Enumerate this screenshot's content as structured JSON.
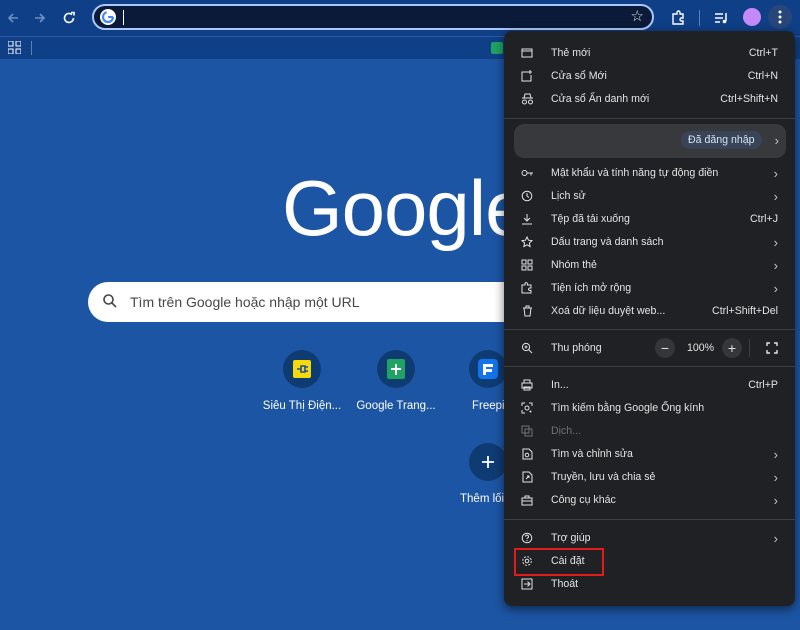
{
  "browser": {
    "omnibox_value": "",
    "bookmarks": [],
    "colors": {
      "page_bg": "#1c55a4",
      "menu_bg": "#202124",
      "highlight": "#e21b1b"
    }
  },
  "newtab": {
    "logo": "Google",
    "search_placeholder": "Tìm trên Google hoặc nhập một URL",
    "shortcuts": [
      {
        "label": "Siêu Thị Điện...",
        "icon": "plug-icon"
      },
      {
        "label": "Google Trang...",
        "icon": "sheets-icon"
      },
      {
        "label": "Freepik",
        "icon": "freepik-icon"
      }
    ],
    "add_shortcut": "Thêm lối"
  },
  "menu": {
    "new_tab": {
      "label": "Thẻ mới",
      "shortcut": "Ctrl+T"
    },
    "new_window": {
      "label": "Cửa sổ Mới",
      "shortcut": "Ctrl+N"
    },
    "incognito": {
      "label": "Cửa sổ Ẩn danh mới",
      "shortcut": "Ctrl+Shift+N"
    },
    "profile_status": "Đã đăng nhập",
    "passwords": "Mật khẩu và tính năng tự động điền",
    "history": "Lịch sử",
    "downloads": {
      "label": "Tệp đã tải xuống",
      "shortcut": "Ctrl+J"
    },
    "bookmarks": "Dấu trang và danh sách",
    "tab_groups": "Nhóm thẻ",
    "extensions": "Tiện ích mở rộng",
    "clear_data": {
      "label": "Xoá dữ liệu duyệt web...",
      "shortcut": "Ctrl+Shift+Del"
    },
    "zoom": {
      "label": "Thu phóng",
      "value": "100%",
      "minus": "−",
      "plus": "+"
    },
    "print": {
      "label": "In...",
      "shortcut": "Ctrl+P"
    },
    "lens": "Tìm kiếm bằng Google Ống kính",
    "translate": "Dịch...",
    "find_edit": "Tìm và chỉnh sửa",
    "cast_save_share": "Truyền, lưu và chia sẻ",
    "more_tools": "Công cụ khác",
    "help": "Trợ giúp",
    "settings": "Cài đặt",
    "exit": "Thoát"
  }
}
